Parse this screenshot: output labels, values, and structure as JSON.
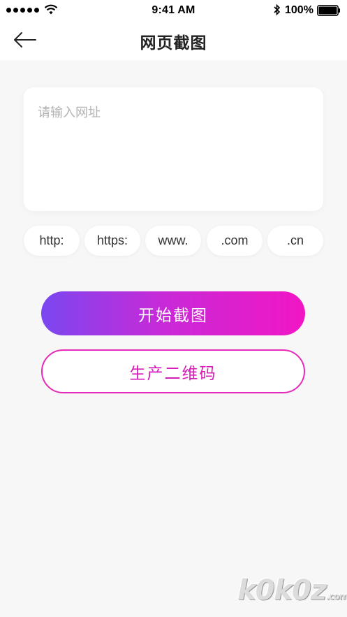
{
  "status_bar": {
    "time": "9:41 AM",
    "battery_percent": "100%",
    "signal_icon": "signal-dots-icon",
    "wifi_icon": "wifi-icon",
    "bluetooth_icon": "bluetooth-icon",
    "battery_icon": "battery-icon",
    "battery_level": 1.0
  },
  "nav": {
    "back_icon": "arrow-left-icon",
    "title": "网页截图"
  },
  "url_input": {
    "placeholder": "请输入网址",
    "value": ""
  },
  "chips": [
    {
      "label": "http:"
    },
    {
      "label": "https:"
    },
    {
      "label": "www."
    },
    {
      "label": ".com"
    },
    {
      "label": ".cn"
    }
  ],
  "actions": {
    "start_label": "开始截图",
    "qr_label": "生产二维码"
  },
  "colors": {
    "gradient_start": "#7a47f0",
    "gradient_end": "#f116c4",
    "accent_pink": "#e62ab9",
    "background": "#f7f7f7"
  },
  "watermark": {
    "text": "k0k0z",
    "suffix": ".com"
  }
}
